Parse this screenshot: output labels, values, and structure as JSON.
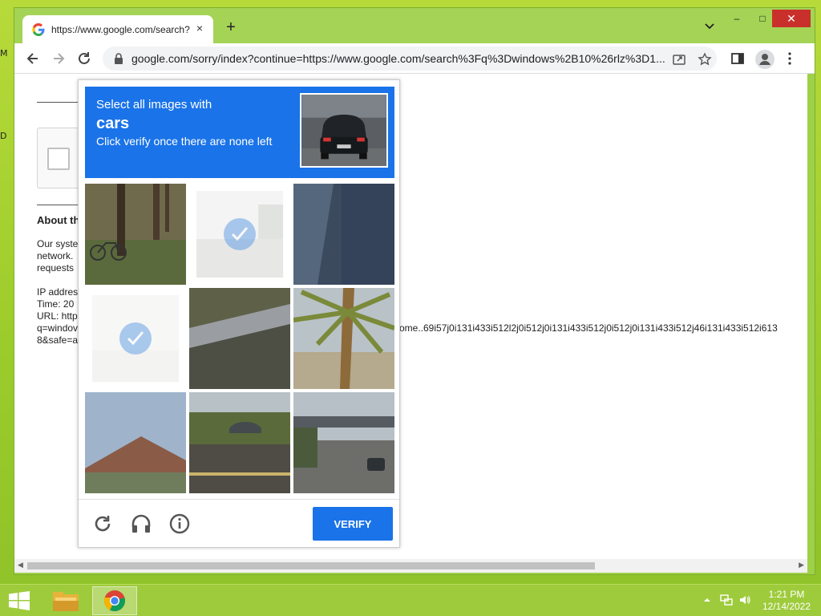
{
  "desktop": {
    "edge_letters": [
      "M",
      "D"
    ]
  },
  "browser": {
    "tab_title": "https://www.google.com/search?",
    "tab_close": "×",
    "new_tab": "+",
    "window_controls": {
      "minimize": "–",
      "maximize": "□",
      "close": "✕"
    },
    "address": "google.com/sorry/index?continue=https://www.google.com/search%3Fq%3Dwindows%2B10%26rlz%3D1..."
  },
  "page": {
    "heading": "About th",
    "body_lines": [
      "Our syste",
      "network.",
      "requests"
    ],
    "ip_label": "IP addres",
    "time_label": "Time: 20",
    "url_label": "URL: http",
    "q_line": "q=windov",
    "safe_line": "8&safe=a",
    "url_tail": "ome..69i57j0i131i433i512l2j0i512j0i131i433i512j0i512j0i131i433i512j46i131i433i512i613"
  },
  "captcha": {
    "line1": "Select all images with",
    "object": "cars",
    "line3": "Click verify once there are none left",
    "verify_label": "VERIFY",
    "tiles": [
      {
        "scene": "trees-bicycle",
        "selected": false
      },
      {
        "scene": "road-hazy",
        "selected": true
      },
      {
        "scene": "blue-surface",
        "selected": false
      },
      {
        "scene": "blank-light",
        "selected": true
      },
      {
        "scene": "guardrail",
        "selected": false
      },
      {
        "scene": "palm-tree",
        "selected": false
      },
      {
        "scene": "house-roof",
        "selected": false
      },
      {
        "scene": "road-car-hedge",
        "selected": false
      },
      {
        "scene": "highway-overpass",
        "selected": false
      }
    ]
  },
  "taskbar": {
    "time": "1:21 PM",
    "date": "12/14/2022"
  },
  "colors": {
    "accent": "#1a73e8",
    "desktop": "#9ccc2b"
  }
}
